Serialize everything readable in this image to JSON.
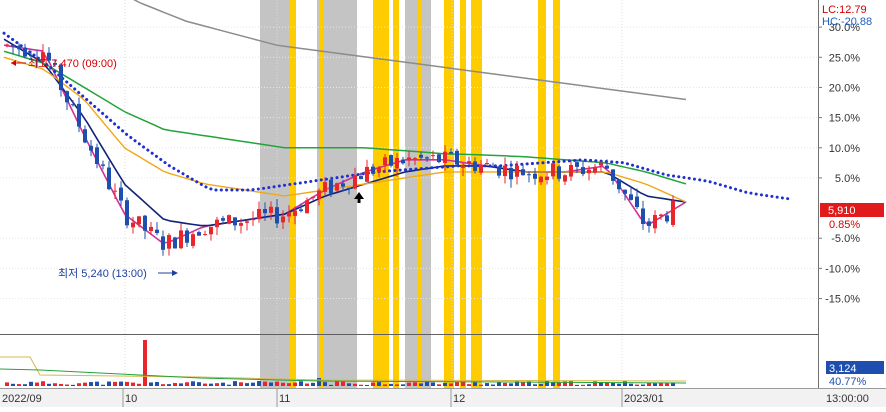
{
  "indicator": {
    "lc_label": "LC:12.79",
    "hc_label": "HC:-20.88",
    "lc_color": "#d40000",
    "hc_color": "#1f5fbf"
  },
  "annotations": {
    "high": "최고 7,470 (09:00)",
    "low": "최저 5,240 (13:00)"
  },
  "price_axis": {
    "ticks": [
      "30.0%",
      "25.0%",
      "20.0%",
      "15.0%",
      "10.0%",
      "5.0%",
      "-5.0%",
      "-10.0%",
      "-15.0%"
    ],
    "tick_values": [
      30,
      25,
      20,
      15,
      10,
      5,
      -5,
      -10,
      -15
    ],
    "current_price": "5,910",
    "current_pct": "0.85%",
    "current_price_color": "#e11b1b",
    "range": [
      -20.88,
      34.5
    ]
  },
  "volume_axis": {
    "value": "3,124",
    "pct": "40.77%",
    "value_bg": "#1f4fae"
  },
  "x_axis": {
    "labels": [
      "2022/09",
      "10",
      "11",
      "12",
      "2023/01",
      "13:00:00"
    ]
  },
  "colors": {
    "up": "#e8262b",
    "down": "#1f4fae",
    "ma_magenta": "#d0309a",
    "ma_navy": "#10237a",
    "ma_orange": "#f0a818",
    "ma_green": "#23a33a",
    "ma_gray": "#8c8c8c",
    "dotted_blue": "#1f2fd0",
    "gray_band": "#c4c4c4",
    "yellow_band": "#ffcc00"
  },
  "chart_data": {
    "type": "line",
    "title": "",
    "xlabel": "",
    "ylabel": "",
    "ylim": [
      -20.88,
      34.5
    ],
    "grid": true,
    "x": [
      "2022/09",
      "10",
      "11",
      "12",
      "2023/01"
    ],
    "series": [
      {
        "name": "",
        "values": [
          27,
          26,
          12,
          -1,
          -6,
          -3,
          -2,
          -1,
          3,
          6,
          8,
          8,
          7,
          6,
          6,
          7,
          -3,
          1
        ]
      },
      {
        "name": "",
        "values": [
          28,
          24,
          15,
          4,
          -2,
          -3,
          -2,
          -1,
          2,
          4,
          6,
          7,
          7,
          6,
          6,
          6,
          2,
          1
        ]
      },
      {
        "name": "",
        "values": [
          25,
          23,
          18,
          10,
          6,
          4,
          3,
          2,
          3,
          4,
          5,
          6,
          6,
          6,
          6,
          6,
          4,
          1
        ]
      },
      {
        "name": "",
        "values": [
          26,
          24,
          20,
          16,
          13,
          12,
          11,
          10,
          10,
          10,
          9.5,
          9,
          8.8,
          8.5,
          8,
          7.5,
          6,
          4
        ]
      },
      {
        "name": "",
        "values": [
          47,
          42,
          38,
          34,
          31,
          29,
          27,
          26,
          25,
          24,
          23,
          22,
          21,
          20,
          19,
          18
        ]
      },
      {
        "name": "",
        "values": [
          29,
          24,
          18,
          12,
          7,
          3,
          3,
          4,
          5,
          6,
          6.5,
          7,
          7,
          7.5,
          8,
          7.5,
          5.5,
          4.5,
          2.5,
          1.5
        ]
      }
    ]
  }
}
